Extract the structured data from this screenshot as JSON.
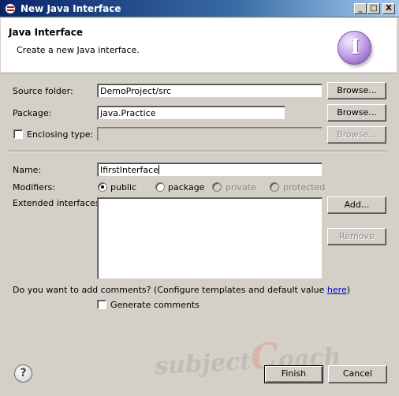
{
  "window": {
    "title": "New Java Interface",
    "controls": [
      "_",
      "□",
      "X"
    ]
  },
  "header": {
    "title": "Java Interface",
    "description": "Create a new Java interface.",
    "logo_letter": "I"
  },
  "form": {
    "source_folder": {
      "label": "Source folder:",
      "value": "DemoProject/src",
      "button": "Browse..."
    },
    "package": {
      "label": "Package:",
      "value": "java.Practice",
      "button": "Browse..."
    },
    "enclosing_type": {
      "label": "Enclosing type:",
      "value": "",
      "button": "Browse...",
      "checked": false
    },
    "name": {
      "label": "Name:",
      "value": "IfirstInterface"
    },
    "modifiers": {
      "label": "Modifiers:",
      "options": [
        "public",
        "package",
        "private",
        "protected"
      ],
      "selected": "public"
    },
    "extended_interfaces": {
      "label": "Extended interfaces:",
      "add_button": "Add...",
      "remove_button": "Remove"
    },
    "comments": {
      "question_prefix": "Do you want to add comments? (Configure templates and default value ",
      "link": "here",
      "question_suffix": ")",
      "checkbox_label": "Generate comments",
      "checked": false
    }
  },
  "footer": {
    "help_label": "?",
    "finish_button": "Finish",
    "cancel_button": "Cancel"
  },
  "watermark": {
    "text_a": "subject",
    "text_c": "C",
    "text_b": "oach"
  }
}
